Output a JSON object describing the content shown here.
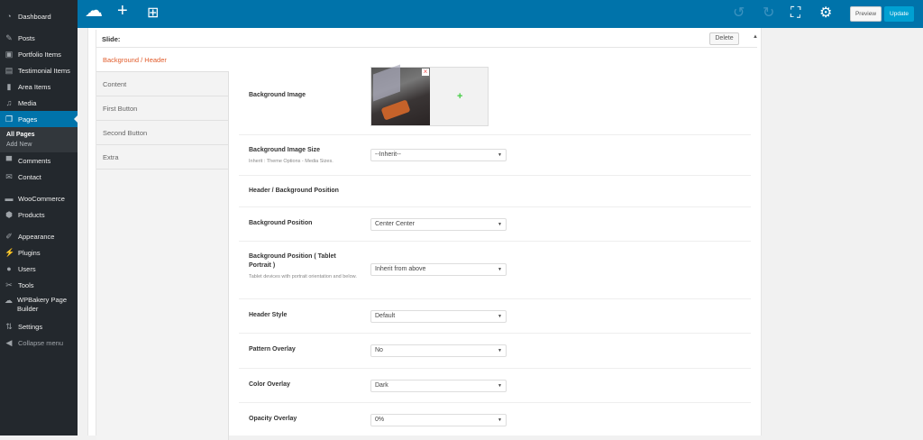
{
  "sidebar": {
    "items": [
      {
        "label": "Dashboard",
        "icon": "dashboard-icon"
      },
      {
        "label": "Posts",
        "icon": "pin-icon"
      },
      {
        "label": "Portfolio Items",
        "icon": "portfolio-icon"
      },
      {
        "label": "Testimonial Items",
        "icon": "testimonial-icon"
      },
      {
        "label": "Area Items",
        "icon": "page-icon"
      },
      {
        "label": "Media",
        "icon": "media-icon"
      },
      {
        "label": "Pages",
        "icon": "pages-icon"
      },
      {
        "label": "Comments",
        "icon": "comment-icon"
      },
      {
        "label": "Contact",
        "icon": "mail-icon"
      },
      {
        "label": "WooCommerce",
        "icon": "woocommerce-icon"
      },
      {
        "label": "Products",
        "icon": "box-icon"
      },
      {
        "label": "Appearance",
        "icon": "brush-icon"
      },
      {
        "label": "Plugins",
        "icon": "plugin-icon"
      },
      {
        "label": "Users",
        "icon": "user-icon"
      },
      {
        "label": "Tools",
        "icon": "wrench-icon"
      },
      {
        "label": "WPBakery Page Builder",
        "icon": "wpbakery-icon"
      },
      {
        "label": "Settings",
        "icon": "settings-icon"
      },
      {
        "label": "Collapse menu",
        "icon": "collapse-icon"
      }
    ],
    "submenu": [
      "All Pages",
      "Add New"
    ]
  },
  "topbar": {
    "preview": "Preview",
    "update": "Update",
    "accent": "#0073aa"
  },
  "panel": {
    "title": "Slide:",
    "delete": "Delete",
    "tabs": [
      "Background / Header",
      "Content",
      "First Button",
      "Second Button",
      "Extra"
    ],
    "rows": {
      "bg_image": {
        "label": "Background Image"
      },
      "bg_size": {
        "label": "Background Image Size",
        "desc": "Inherit : Theme Options - Media Sizes.",
        "value": "--Inherit--"
      },
      "hdr_pos": {
        "label": "Header / Background Position"
      },
      "bg_pos": {
        "label": "Background Position",
        "value": "Center Center"
      },
      "bg_tab": {
        "label": "Background Position ( Tablet Portrait )",
        "desc": "Tablet devices with portrait orientation and below.",
        "value": "Inherit from above"
      },
      "hdr_style": {
        "label": "Header Style",
        "value": "Default"
      },
      "pattern": {
        "label": "Pattern Overlay",
        "value": "No"
      },
      "color": {
        "label": "Color Overlay",
        "value": "Dark"
      },
      "opacity": {
        "label": "Opacity Overlay",
        "value": "0%"
      }
    }
  }
}
